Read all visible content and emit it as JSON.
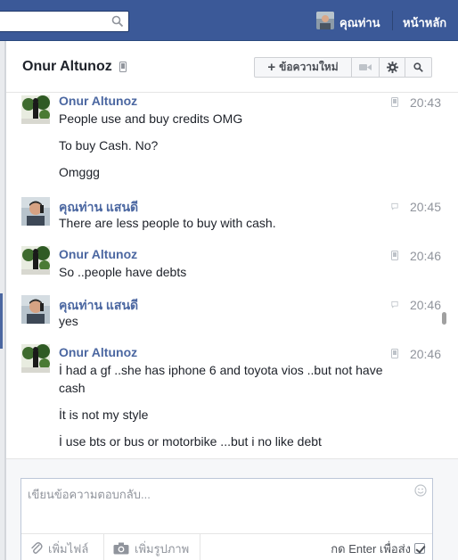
{
  "topbar": {
    "search_placeholder": "",
    "user_name": "คุณท่าน",
    "home_label": "หน้าหลัก",
    "brand_color": "#3b5998"
  },
  "conversation": {
    "title": "Onur Altunoz",
    "new_message_label": "ข้อความใหม่",
    "icons": [
      "phone-icon",
      "video-icon",
      "gear-icon",
      "search-icon"
    ]
  },
  "messages": [
    {
      "sender": "Onur Altunoz",
      "time": "20:43",
      "via": "mobile",
      "lines": [
        "People use and buy credits OMG",
        "To buy Cash. No?",
        "Omggg"
      ]
    },
    {
      "sender": "คุณท่าน แสนดี",
      "time": "20:45",
      "via": "chat",
      "lines": [
        "There are less people to buy with cash."
      ]
    },
    {
      "sender": "Onur Altunoz",
      "time": "20:46",
      "via": "mobile",
      "lines": [
        "So ..people have debts"
      ]
    },
    {
      "sender": "คุณท่าน แสนดี",
      "time": "20:46",
      "via": "chat",
      "lines": [
        "yes"
      ]
    },
    {
      "sender": "Onur Altunoz",
      "time": "20:46",
      "via": "mobile",
      "lines": [
        "İ had a gf ..she has iphone 6 and toyota vios ..but not have",
        "cash",
        "İt is not my style",
        "İ use bts or bus or motorbike ...but i no like debt"
      ]
    }
  ],
  "composer": {
    "placeholder": "เขียนข้อความตอบกลับ...",
    "add_file_label": "เพิ่มไฟล์",
    "add_photo_label": "เพิ่มรูปภาพ",
    "enter_to_send_label": "กด Enter เพื่อส่ง",
    "enter_to_send_checked": true
  }
}
